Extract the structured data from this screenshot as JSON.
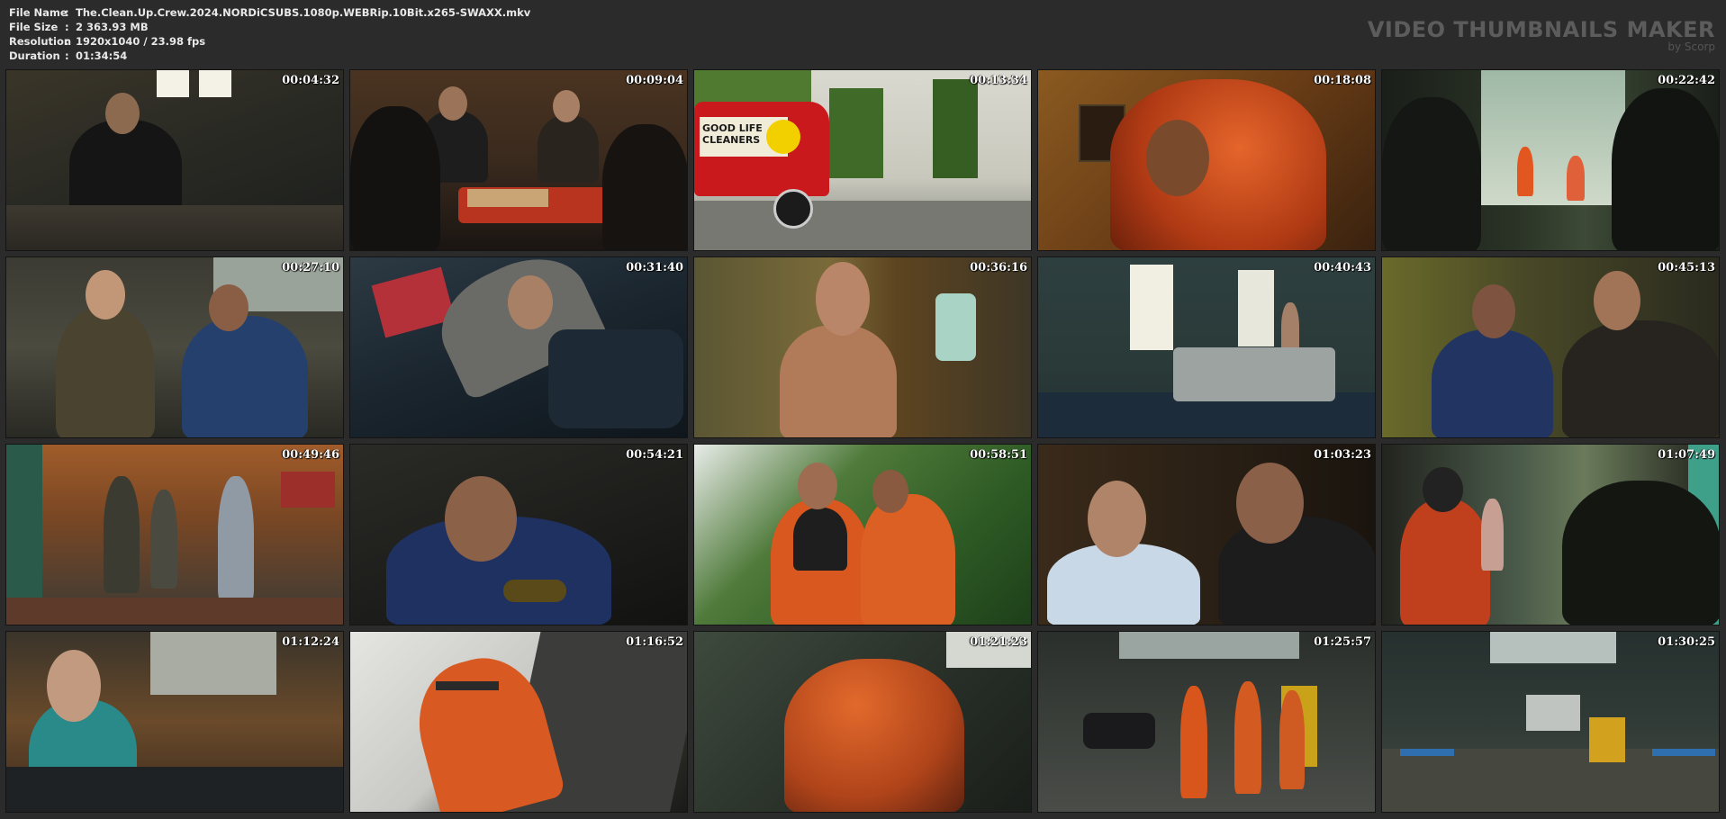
{
  "file_info": {
    "rows": [
      {
        "label": "File Name",
        "value": "The.Clean.Up.Crew.2024.NORDiCSUBS.1080p.WEBRip.10Bit.x265-SWAXX.mkv"
      },
      {
        "label": "File Size",
        "value": "2 363.93 MB"
      },
      {
        "label": "Resolution",
        "value": "1920x1040 / 23.98 fps"
      },
      {
        "label": "Duration",
        "value": "01:34:54"
      }
    ],
    "separator": ":"
  },
  "brand": {
    "title": "VIDEO THUMBNAILS MAKER",
    "subtitle": "by Scorp"
  },
  "thumbnails": [
    {
      "time": "00:04:32"
    },
    {
      "time": "00:09:04"
    },
    {
      "time": "00:13:34"
    },
    {
      "time": "00:18:08"
    },
    {
      "time": "00:22:42"
    },
    {
      "time": "00:27:10"
    },
    {
      "time": "00:31:40"
    },
    {
      "time": "00:36:16"
    },
    {
      "time": "00:40:43"
    },
    {
      "time": "00:45:13"
    },
    {
      "time": "00:49:46"
    },
    {
      "time": "00:54:21"
    },
    {
      "time": "00:58:51"
    },
    {
      "time": "01:03:23"
    },
    {
      "time": "01:07:49"
    },
    {
      "time": "01:12:24"
    },
    {
      "time": "01:16:52"
    },
    {
      "time": "01:21:23"
    },
    {
      "time": "01:25:57"
    },
    {
      "time": "01:30:25"
    }
  ],
  "van_sign": {
    "line1": "GOOD LIFE",
    "line2": "CLEANERS"
  }
}
